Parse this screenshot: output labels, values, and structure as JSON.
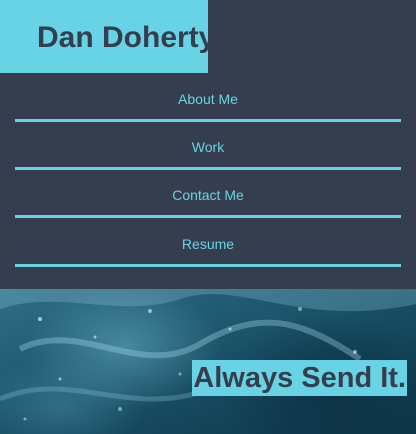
{
  "header": {
    "brand_name": "Dan Doherty"
  },
  "nav": {
    "items": [
      {
        "label": "About Me"
      },
      {
        "label": "Work"
      },
      {
        "label": "Contact Me"
      },
      {
        "label": "Resume"
      }
    ]
  },
  "hero": {
    "tagline": "Always Send It.",
    "background": "ocean-wave-image"
  },
  "colors": {
    "background": "#353e4f",
    "accent": "#69d3e6"
  }
}
